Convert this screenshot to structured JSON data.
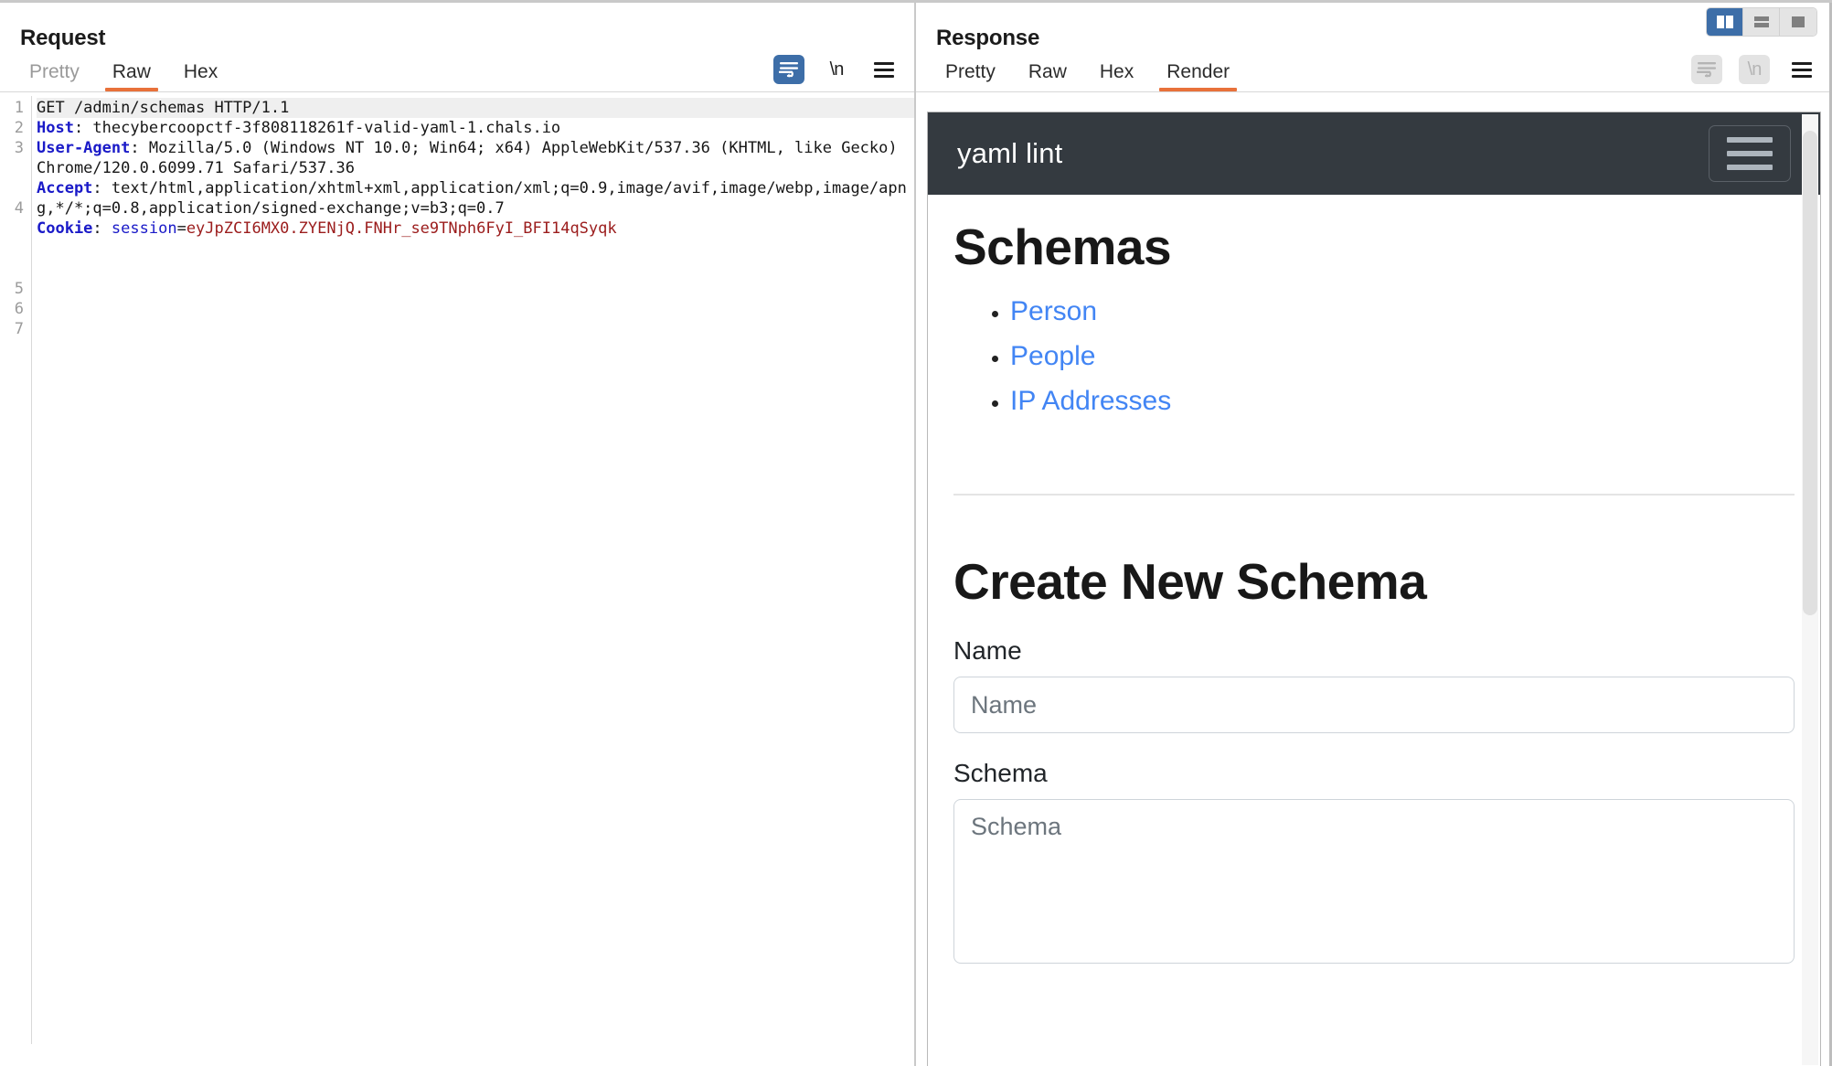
{
  "layout_toggle": {
    "buttons": [
      {
        "name": "side-by-side-layout",
        "state": "active"
      },
      {
        "name": "stacked-layout",
        "state": "inactive"
      },
      {
        "name": "single-pane-layout",
        "state": "inactive"
      }
    ]
  },
  "request": {
    "title": "Request",
    "tabs": [
      {
        "label": "Pretty",
        "active": false,
        "muted": true
      },
      {
        "label": "Raw",
        "active": true,
        "muted": false
      },
      {
        "label": "Hex",
        "active": false,
        "muted": false
      }
    ],
    "tools": {
      "wrap_icon": "word-wrap-icon",
      "newline_label": "\\n",
      "menu_icon": "hamburger-menu-icon"
    },
    "line_numbers": [
      "1",
      "2",
      "3",
      "",
      "",
      "4",
      "",
      "",
      "",
      "5",
      "6",
      "7"
    ],
    "raw": {
      "line1": "GET /admin/schemas HTTP/1.1",
      "line2_key": "Host",
      "line2_val": ": thecybercoopctf-3f808118261f-valid-yaml-1.chals.io",
      "line3_key": "User-Agent",
      "line3_val": ": Mozilla/5.0 (Windows NT 10.0; Win64; x64) AppleWebKit/537.36 (KHTML, like Gecko) Chrome/120.0.6099.71 Safari/537.36",
      "line4_key": "Accept",
      "line4_val": ": text/html,application/xhtml+xml,application/xml;q=0.9,image/avif,image/webp,image/apng,*/*;q=0.8,application/signed-exchange;v=b3;q=0.7",
      "line5_key": "Cookie",
      "line5_sep": ": ",
      "line5_cookie_name": "session",
      "line5_eq": "=",
      "line5_cookie_value": "eyJpZCI6MX0.ZYENjQ.FNHr_se9TNph6FyI_BFI14qSyqk"
    }
  },
  "response": {
    "title": "Response",
    "tabs": [
      {
        "label": "Pretty",
        "active": false,
        "muted": false
      },
      {
        "label": "Raw",
        "active": false,
        "muted": false
      },
      {
        "label": "Hex",
        "active": false,
        "muted": false
      },
      {
        "label": "Render",
        "active": true,
        "muted": false
      }
    ],
    "tools": {
      "wrap_icon": "word-wrap-icon",
      "newline_label": "\\n",
      "menu_icon": "hamburger-menu-icon"
    },
    "render": {
      "navbar": {
        "brand": "yaml lint",
        "toggler_icon": "hamburger-menu-icon"
      },
      "schemas_heading": "Schemas",
      "schema_links": [
        {
          "label": "Person"
        },
        {
          "label": "People"
        },
        {
          "label": "IP Addresses"
        }
      ],
      "create_heading": "Create New Schema",
      "name_label": "Name",
      "name_placeholder": "Name",
      "name_value": "",
      "schema_label": "Schema",
      "schema_placeholder": "Schema",
      "schema_value": ""
    }
  },
  "colors": {
    "accent_orange": "#e8713a",
    "active_blue": "#3d6ea8",
    "navbar_dark": "#343a40",
    "link_blue": "#4285f4",
    "header_blue": "#1a1ac8",
    "cookie_red": "#9b1c1c"
  }
}
